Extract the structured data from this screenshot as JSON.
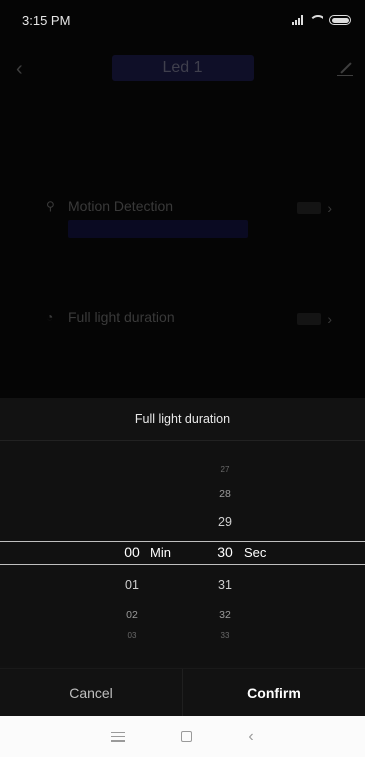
{
  "status_bar": {
    "time": "3:15 PM"
  },
  "header": {
    "title": "Led 1"
  },
  "settings": [
    {
      "label": "Motion Detection",
      "icon": "motion-icon"
    },
    {
      "label": "Full light duration",
      "icon": "light-icon"
    }
  ],
  "picker": {
    "title": "Full light duration",
    "minutes": {
      "unit": "Min",
      "items": [
        "00",
        "01",
        "02",
        "03"
      ],
      "selected": "00"
    },
    "seconds": {
      "unit": "Sec",
      "items": [
        "27",
        "28",
        "29",
        "30",
        "31",
        "32",
        "33"
      ],
      "selected": "30"
    }
  },
  "actions": {
    "cancel_label": "Cancel",
    "confirm_label": "Confirm"
  }
}
